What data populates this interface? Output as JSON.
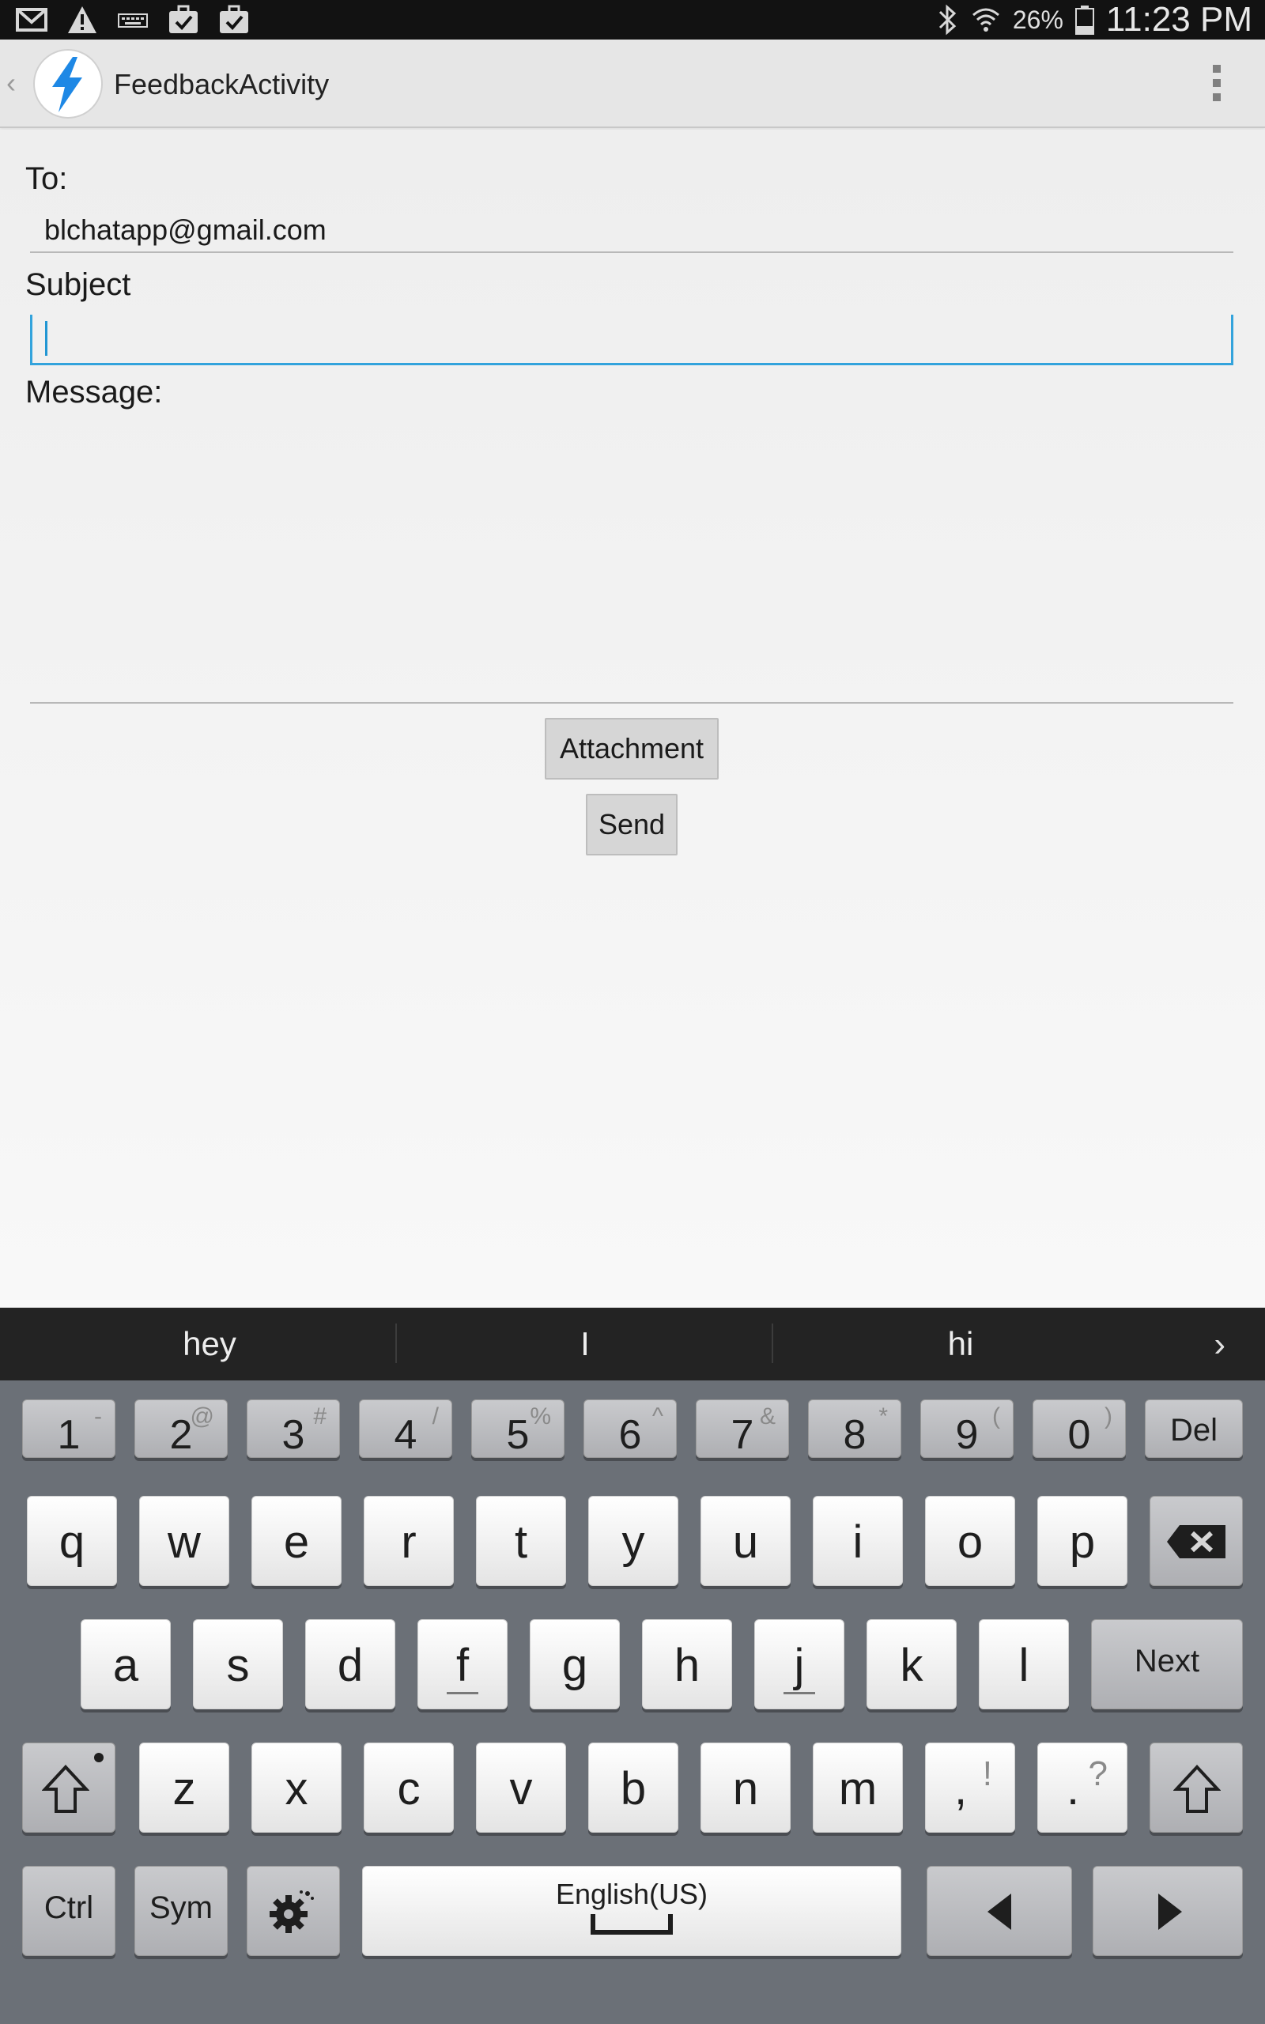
{
  "status_bar": {
    "battery_percent": "26%",
    "time": "11:23 PM",
    "icons": [
      "gmail-icon",
      "warning-icon",
      "keyboard-icon",
      "briefcase-check-icon",
      "briefcase-check-icon",
      "bluetooth-icon",
      "wifi-icon",
      "battery-icon"
    ]
  },
  "action_bar": {
    "title": "FeedbackActivity",
    "logo_color": "#1e88e5"
  },
  "form": {
    "to_label": "To:",
    "to_value": "blchatapp@gmail.com",
    "subject_label": "Subject",
    "subject_value": "",
    "message_label": "Message:",
    "message_value": "",
    "attachment_button": "Attachment",
    "send_button": "Send",
    "focus_color": "#33a3dc"
  },
  "suggestions": [
    "hey",
    "I",
    "hi"
  ],
  "keyboard": {
    "number_row": [
      {
        "main": "1",
        "sub": "-"
      },
      {
        "main": "2",
        "sub": "@"
      },
      {
        "main": "3",
        "sub": "#"
      },
      {
        "main": "4",
        "sub": "/"
      },
      {
        "main": "5",
        "sub": "%"
      },
      {
        "main": "6",
        "sub": "^"
      },
      {
        "main": "7",
        "sub": "&"
      },
      {
        "main": "8",
        "sub": "*"
      },
      {
        "main": "9",
        "sub": "("
      },
      {
        "main": "0",
        "sub": ")"
      }
    ],
    "del_label": "Del",
    "row1": [
      "q",
      "w",
      "e",
      "r",
      "t",
      "y",
      "u",
      "i",
      "o",
      "p"
    ],
    "row2": [
      "a",
      "s",
      "d",
      "f",
      "g",
      "h",
      "j",
      "k",
      "l"
    ],
    "next_label": "Next",
    "row3": [
      "z",
      "x",
      "c",
      "v",
      "b",
      "n",
      "m"
    ],
    "comma_key": {
      "main": ",",
      "sub": "!"
    },
    "period_key": {
      "main": ".",
      "sub": "?"
    },
    "ctrl_label": "Ctrl",
    "sym_label": "Sym",
    "space_label": "English(US)"
  }
}
